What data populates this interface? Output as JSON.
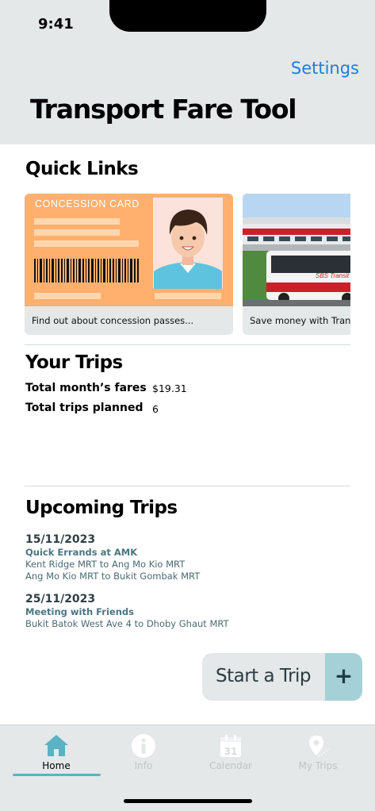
{
  "status_bar": {
    "time": "9:41"
  },
  "header": {
    "settings_label": "Settings",
    "title": "Transport Fare Tool"
  },
  "quick_links": {
    "title": "Quick Links",
    "cards": [
      {
        "caption": "Find out about concession passes...",
        "art_text": "CONCESSION CARD"
      },
      {
        "caption": "Save money with Transit",
        "art_text": "SBS Transit"
      }
    ]
  },
  "your_trips": {
    "title": "Your Trips",
    "stats": [
      {
        "label": "Total month’s fares",
        "value": "$19.31"
      },
      {
        "label": "Total trips planned",
        "value": "6"
      }
    ]
  },
  "upcoming_trips": {
    "title": "Upcoming Trips",
    "trips": [
      {
        "date": "15/11/2023",
        "name": "Quick Errands at AMK",
        "routes": [
          "Kent Ridge MRT to Ang Mo Kio MRT",
          "Ang Mo Kio MRT to Bukit Gombak MRT"
        ]
      },
      {
        "date": "25/11/2023",
        "name": "Meeting with Friends",
        "routes": [
          "Bukit Batok West Ave 4 to Dhoby Ghaut MRT"
        ]
      }
    ]
  },
  "start_trip": {
    "label": "Start a Trip",
    "plus": "+"
  },
  "tabbar": {
    "tabs": [
      {
        "label": "Home",
        "icon": "home-icon",
        "active": true
      },
      {
        "label": "Info",
        "icon": "info-icon",
        "active": false
      },
      {
        "label": "Calendar",
        "icon": "calendar-icon",
        "active": false,
        "icon_text": "31"
      },
      {
        "label": "My Trips",
        "icon": "map-pin-icon",
        "active": false
      }
    ]
  },
  "colors": {
    "accent_blue": "#1a7ee6",
    "active_teal": "#5bb2c3",
    "card_orange": "#ffb06e",
    "header_gray": "#e4e8e9"
  }
}
